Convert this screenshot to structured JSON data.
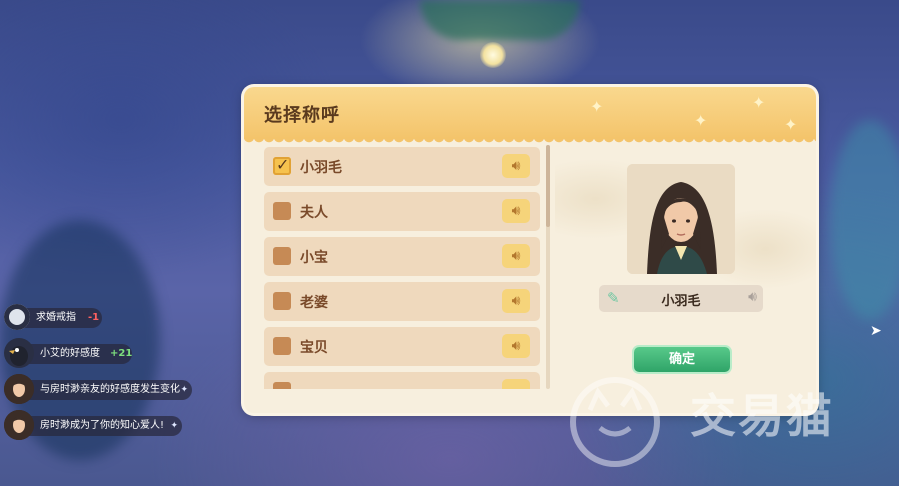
{
  "dialog": {
    "title": "选择称呼",
    "options": [
      {
        "label": "小羽毛",
        "checked": true
      },
      {
        "label": "夫人",
        "checked": false
      },
      {
        "label": "小宝",
        "checked": false
      },
      {
        "label": "老婆",
        "checked": false
      },
      {
        "label": "宝贝",
        "checked": false
      }
    ],
    "selected_name": "小羽毛",
    "confirm_label": "确定"
  },
  "notifications": [
    {
      "text": "求婚戒指",
      "badge": "-1",
      "icon": "ring-icon"
    },
    {
      "text": "小艾的好感度",
      "badge": "+21",
      "icon": "crow-avatar"
    },
    {
      "text": "与房时渺亲友的好感度发生变化",
      "icon": "character-avatar"
    },
    {
      "text": "房时渺成为了你的知心爱人!",
      "icon": "character-avatar"
    }
  ],
  "watermark": {
    "text": "交易猫"
  },
  "colors": {
    "header": "#f4c46b",
    "panel": "#f7efde",
    "confirm": "#2fa468",
    "row": "#efd9bd"
  }
}
